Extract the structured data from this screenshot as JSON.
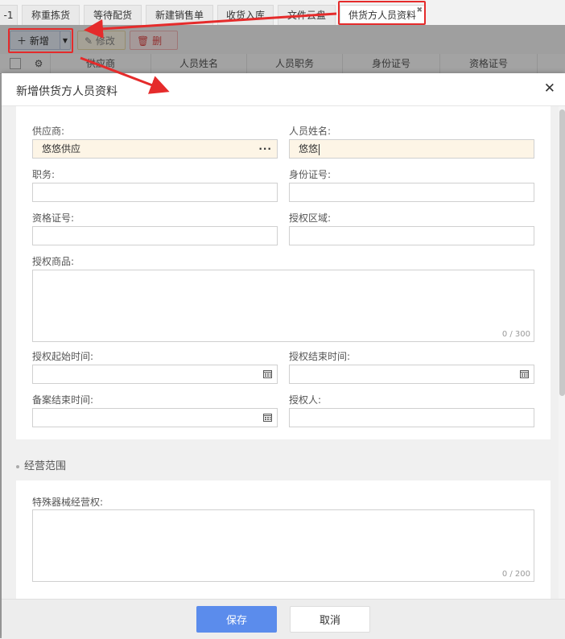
{
  "tabs": [
    {
      "label": "-1"
    },
    {
      "label": "称重拣货"
    },
    {
      "label": "等待配货"
    },
    {
      "label": "新建销售单"
    },
    {
      "label": "收货入库"
    },
    {
      "label": "文件云盘"
    },
    {
      "label": "供货方人员资料"
    }
  ],
  "toolbar": {
    "new_label": "新增",
    "edit_label": "修改",
    "delete_label": "删除"
  },
  "grid": {
    "columns": [
      "供应商",
      "人员姓名",
      "人员职务",
      "身份证号",
      "资格证号"
    ]
  },
  "modal": {
    "title": "新增供货方人员资料",
    "fields": {
      "supplier": {
        "label": "供应商:",
        "value": "悠悠供应"
      },
      "person_name": {
        "label": "人员姓名:",
        "value": "悠悠"
      },
      "position": {
        "label": "职务:",
        "value": ""
      },
      "id_number": {
        "label": "身份证号:",
        "value": ""
      },
      "qualification": {
        "label": "资格证号:",
        "value": ""
      },
      "auth_region": {
        "label": "授权区域:",
        "value": ""
      },
      "auth_goods": {
        "label": "授权商品:",
        "value": "",
        "count": "0 / 300"
      },
      "auth_start": {
        "label": "授权起始时间:",
        "value": ""
      },
      "auth_end": {
        "label": "授权结束时间:",
        "value": ""
      },
      "filing_end": {
        "label": "备案结束时间:",
        "value": ""
      },
      "authorizer": {
        "label": "授权人:",
        "value": ""
      }
    },
    "section": {
      "title": "经营范围"
    },
    "special": {
      "label": "特殊器械经营权:",
      "value": "",
      "count": "0 / 200"
    },
    "save_label": "保存",
    "cancel_label": "取消"
  },
  "colors": {
    "primary": "#5b8cec",
    "annotation": "#e52b2b",
    "filled_input": "#fdf5e6"
  }
}
